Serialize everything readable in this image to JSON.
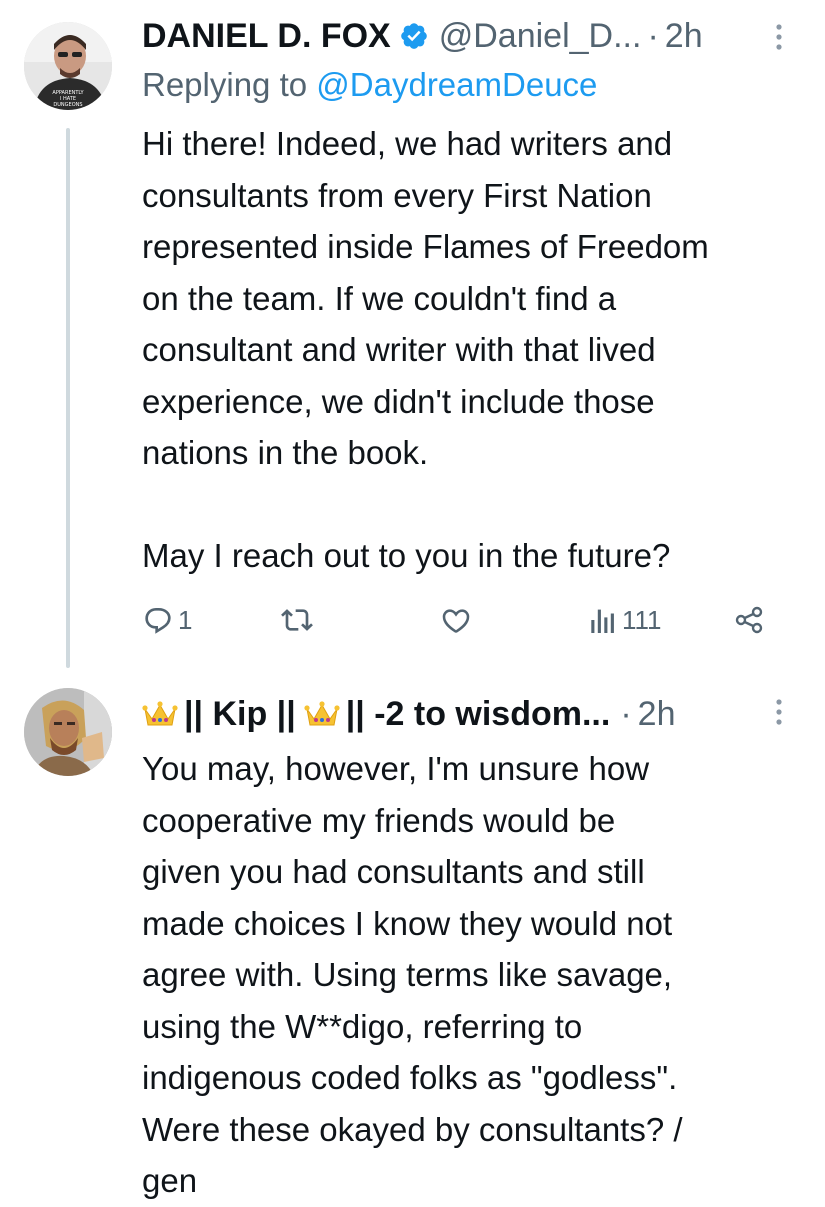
{
  "tweet1": {
    "display_name": "DANIEL D. FOX",
    "handle": "@Daniel_D...",
    "separator": "·",
    "time": "2h",
    "replying_prefix": "Replying to",
    "replying_handle": "@DaydreamDeuce",
    "avatar_shirt_text": "APPARENTLY I HATE DUNGEONS & DRAGONS",
    "body": "Hi there! Indeed, we had writers and\nconsultants from every First Nation\nrepresented inside Flames of Freedom\non the team. If we couldn't find a\nconsultant and writer with that lived\nexperience, we didn't include those\nnations in the book.\n\nMay I reach out to you in the future?",
    "actions": {
      "reply_count": "1",
      "views_count": "111"
    }
  },
  "tweet2": {
    "name_part1": "|| Kip ||",
    "name_part2": "|| -2 to wisdom...",
    "separator": "·",
    "time": "2h",
    "body": "You may, however, I'm unsure how\ncooperative my friends would be\ngiven you had consultants and still\nmade choices I know they would not\nagree with. Using terms like savage,\nusing the W**digo, referring to\nindigenous coded folks as \"godless\".\nWere these okayed by consultants? /\ngen"
  },
  "colors": {
    "text": "#0f1419",
    "secondary": "#536471",
    "link": "#1d9bf0",
    "thread_line": "#cfd9de"
  }
}
